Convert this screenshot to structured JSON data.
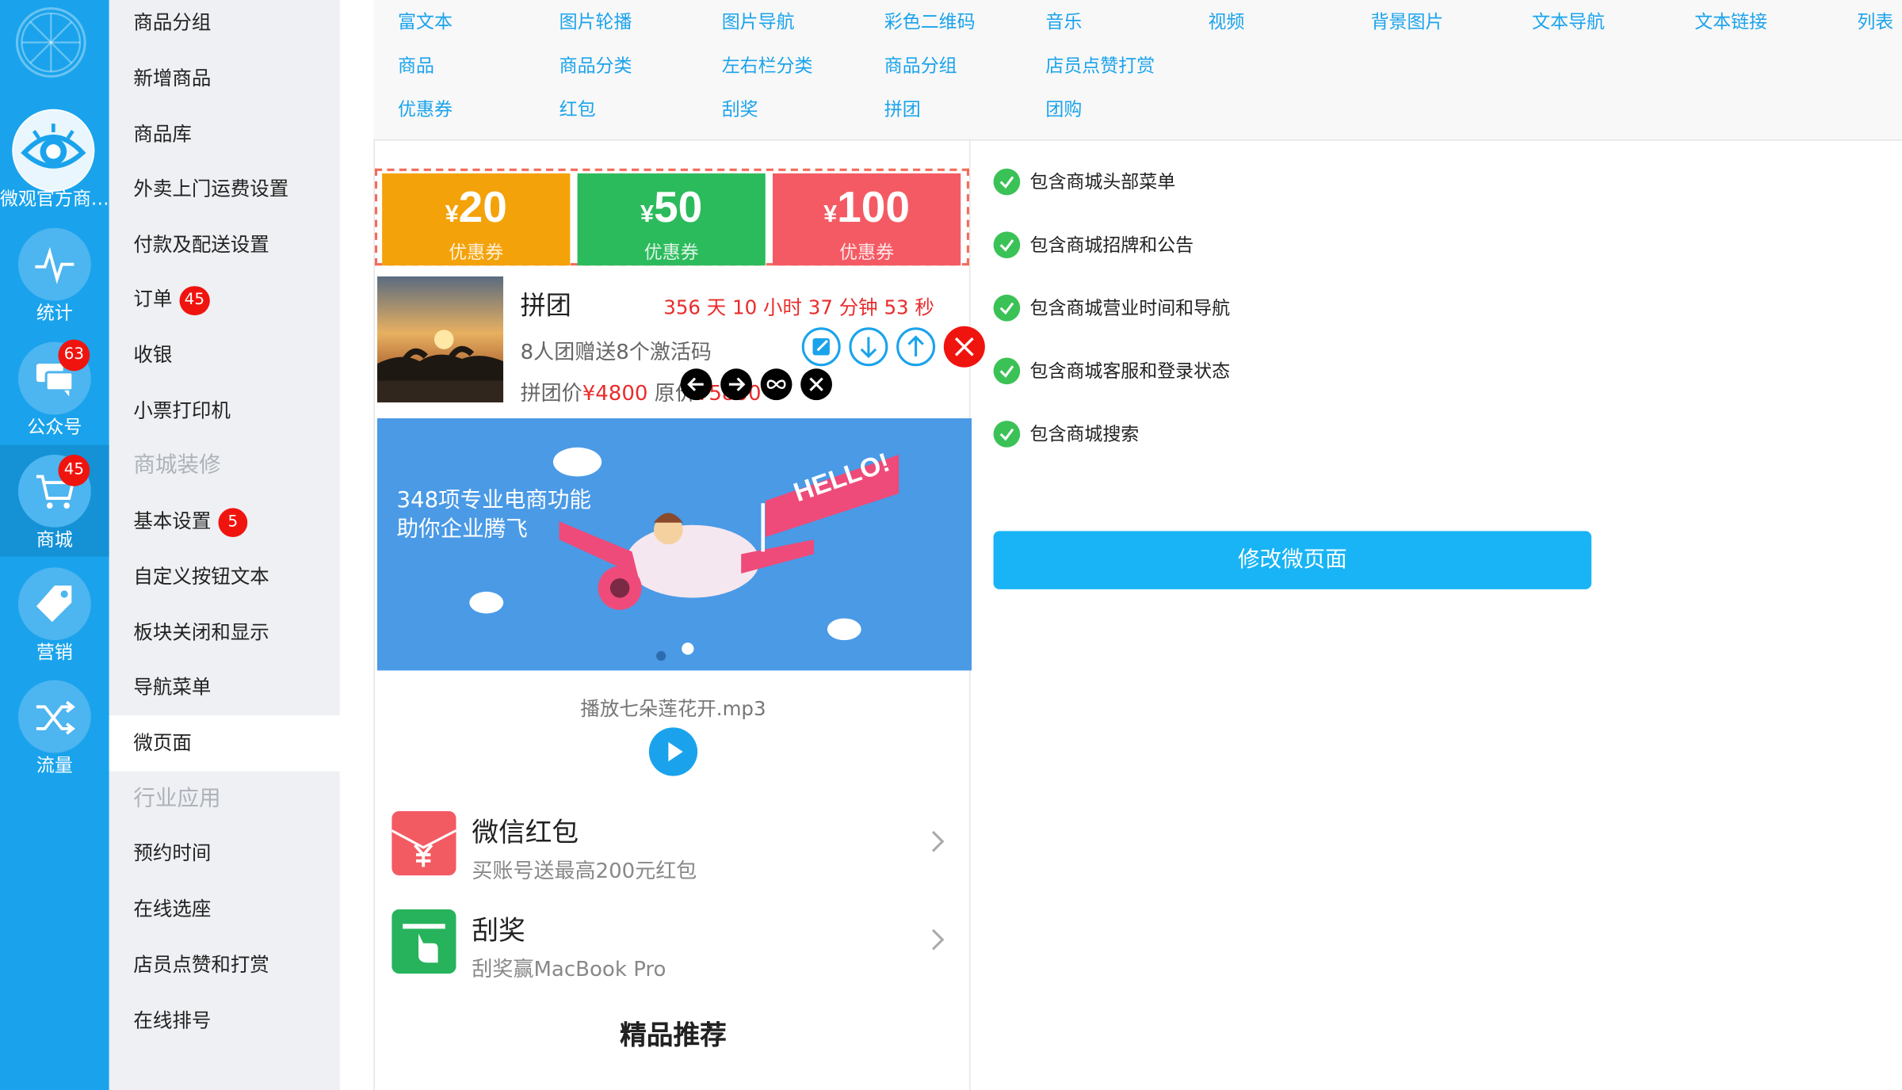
{
  "rail": {
    "items": [
      {
        "label": "微观官方商…",
        "badge": null
      },
      {
        "label": "统计",
        "badge": null
      },
      {
        "label": "公众号",
        "badge": "63"
      },
      {
        "label": "商城",
        "badge": "45"
      },
      {
        "label": "营销",
        "badge": null
      },
      {
        "label": "流量",
        "badge": null
      }
    ]
  },
  "menu": {
    "items": [
      {
        "label": "商品分组",
        "badge": null
      },
      {
        "label": "新增商品",
        "badge": null
      },
      {
        "label": "商品库",
        "badge": null
      },
      {
        "label": "外卖上门运费设置",
        "badge": null
      },
      {
        "label": "付款及配送设置",
        "badge": null
      },
      {
        "label": "订单",
        "badge": "45"
      },
      {
        "label": "收银",
        "badge": null
      },
      {
        "label": "小票打印机",
        "badge": null
      },
      {
        "label": "商城装修",
        "badge": null
      },
      {
        "label": "基本设置",
        "badge": "5"
      },
      {
        "label": "自定义按钮文本",
        "badge": null
      },
      {
        "label": "板块关闭和显示",
        "badge": null
      },
      {
        "label": "导航菜单",
        "badge": null
      },
      {
        "label": "微页面",
        "badge": null
      },
      {
        "label": "行业应用",
        "badge": null
      },
      {
        "label": "预约时间",
        "badge": null
      },
      {
        "label": "在线选座",
        "badge": null
      },
      {
        "label": "店员点赞和打赏",
        "badge": null
      },
      {
        "label": "在线排号",
        "badge": null
      }
    ]
  },
  "palette": {
    "row1": [
      "富文本",
      "图片轮播",
      "图片导航",
      "彩色二维码",
      "音乐",
      "视频",
      "背景图片",
      "文本导航",
      "文本链接",
      "列表"
    ],
    "row2": [
      "商品",
      "商品分类",
      "左右栏分类",
      "商品分组",
      "店员点赞打赏"
    ],
    "row3": [
      "优惠券",
      "红包",
      "刮奖",
      "拼团",
      "团购"
    ]
  },
  "coupons": [
    {
      "currency": "¥",
      "amount": "20",
      "label": "优惠券",
      "color": "#f4a20a"
    },
    {
      "currency": "¥",
      "amount": "50",
      "label": "优惠券",
      "color": "#2cbb5c"
    },
    {
      "currency": "¥",
      "amount": "100",
      "label": "优惠券",
      "color": "#f45a63"
    }
  ],
  "group_buy": {
    "title": "拼团",
    "timer": "356 天 10 小时 37 分钟 53 秒",
    "desc": "8人团赠送8个激活码",
    "price_label": "拼团价",
    "price": "¥4800",
    "orig_label": "原价",
    "orig_price": "¥5800"
  },
  "banner": {
    "line1": "348项专业电商功能",
    "line2": "助你企业腾飞",
    "flag_text": "HELLO!"
  },
  "music": {
    "title": "播放七朵莲花开.mp3"
  },
  "list": [
    {
      "title": "微信红包",
      "sub": "买账号送最高200元红包",
      "color": "#f35b63"
    },
    {
      "title": "刮奖",
      "sub": "刮奖赢MacBook Pro",
      "color": "#27b35c"
    }
  ],
  "recommend": "精品推荐",
  "settings": {
    "checks": [
      "包含商城头部菜单",
      "包含商城招牌和公告",
      "包含商城营业时间和导航",
      "包含商城客服和登录状态",
      "包含商城搜索"
    ],
    "button": "修改微页面"
  },
  "colors": {
    "rail_bg": "#1aa3ec",
    "accent": "#1aa3ec",
    "badge": "#f0140f",
    "check": "#3bc256",
    "button": "#18b4f5"
  }
}
